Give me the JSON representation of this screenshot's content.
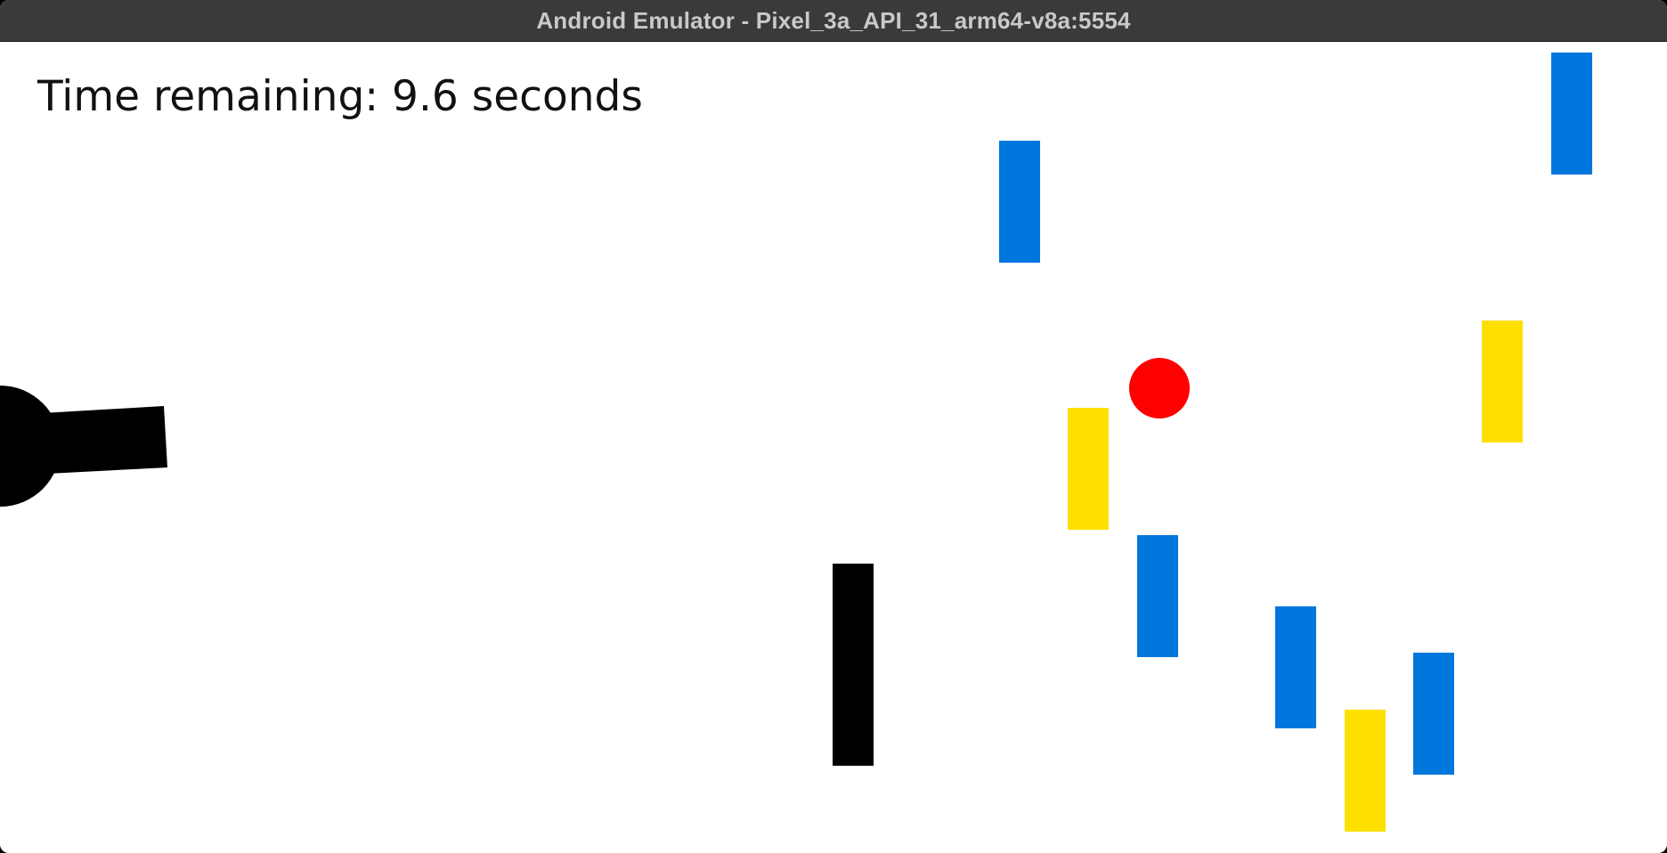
{
  "window": {
    "title": "Android Emulator - Pixel_3a_API_31_arm64-v8a:5554"
  },
  "hud": {
    "time_remaining_text": "Time remaining: 9.6 seconds"
  },
  "colors": {
    "background": "#ffffff",
    "blue_block": "#0077dd",
    "yellow_block": "#fde000",
    "obstacle": "#000000",
    "ball": "#ff0000",
    "cannon": "#000000"
  },
  "game_objects": {
    "cannon": {
      "color": "black"
    },
    "ball": {
      "color": "red"
    },
    "obstacle": {
      "color": "black"
    },
    "blocks": [
      {
        "color": "blue"
      },
      {
        "color": "blue"
      },
      {
        "color": "yellow"
      },
      {
        "color": "yellow"
      },
      {
        "color": "blue"
      },
      {
        "color": "blue"
      },
      {
        "color": "yellow"
      },
      {
        "color": "blue"
      }
    ]
  }
}
